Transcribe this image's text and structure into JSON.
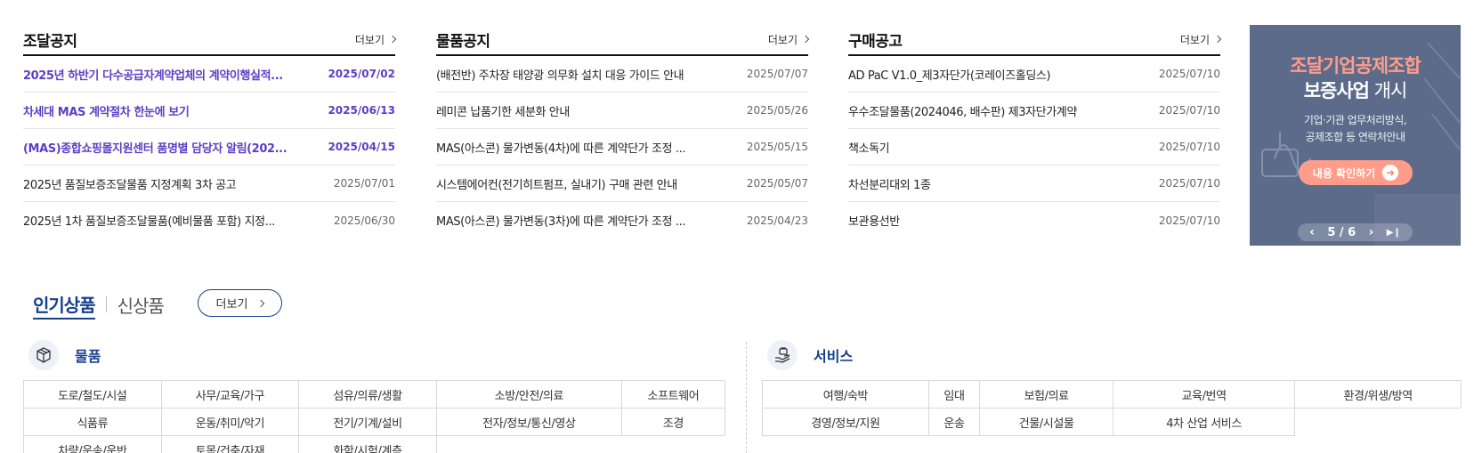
{
  "notices": [
    {
      "title": "조달공지",
      "more": "더보기",
      "items": [
        {
          "title": "2025년 하반기 다수공급자계약업체의 계약이행실적...",
          "date": "2025/07/02",
          "hl": true
        },
        {
          "title": "차세대 MAS 계약절차 한눈에 보기",
          "date": "2025/06/13",
          "hl": true
        },
        {
          "title": "(MAS)종합쇼핑몰지원센터 품명별 담당자 알림(202...",
          "date": "2025/04/15",
          "hl": true
        },
        {
          "title": "2025년 품질보증조달물품 지정계획 3차 공고",
          "date": "2025/07/01",
          "hl": false
        },
        {
          "title": "2025년 1차 품질보증조달물품(예비물품 포함) 지정...",
          "date": "2025/06/30",
          "hl": false
        }
      ]
    },
    {
      "title": "물품공지",
      "more": "더보기",
      "items": [
        {
          "title": "(배전반) 주차장 태양광 의무화 설치 대응 가이드 안내",
          "date": "2025/07/07",
          "hl": false
        },
        {
          "title": "레미콘 납품기한 세분화 안내",
          "date": "2025/05/26",
          "hl": false
        },
        {
          "title": "MAS(아스콘) 물가변동(4차)에 따른 계약단가 조정 ...",
          "date": "2025/05/15",
          "hl": false
        },
        {
          "title": "시스템에어컨(전기히트펌프, 실내기) 구매 관련 안내",
          "date": "2025/05/07",
          "hl": false
        },
        {
          "title": "MAS(아스콘) 물가변동(3차)에 따른 계약단가 조정 ...",
          "date": "2025/04/23",
          "hl": false
        }
      ]
    },
    {
      "title": "구매공고",
      "more": "더보기",
      "items": [
        {
          "title": "AD PaC V1.0_제3자단가(코레이즈홀딩스)",
          "date": "2025/07/10",
          "hl": false
        },
        {
          "title": "우수조달물품(2024046, 배수판) 제3자단가계약",
          "date": "2025/07/10",
          "hl": false
        },
        {
          "title": "책소독기",
          "date": "2025/07/10",
          "hl": false
        },
        {
          "title": "차선분리대외 1종",
          "date": "2025/07/10",
          "hl": false
        },
        {
          "title": "보관용선반",
          "date": "2025/07/10",
          "hl": false
        }
      ]
    }
  ],
  "banner": {
    "title_line1": "조달기업공제조합",
    "title_line2_bold": "보증사업",
    "title_line2_rest": " 개시",
    "sub_line1": "기업·기관 업무처리방식,",
    "sub_line2": "공제조합 등 연락처안내",
    "button_label": "내용 확인하기",
    "pager": "5 / 6",
    "colors": {
      "background": "#5c6b8a",
      "accent": "#ff9c8a"
    }
  },
  "products": {
    "tab_popular": "인기상품",
    "tab_new": "신상품",
    "more": "더보기",
    "goods": {
      "label": "물품",
      "rows": [
        [
          "도로/철도/시설",
          "사무/교육/가구",
          "섬유/의류/생활",
          "소방/안전/의료",
          "소프트웨어"
        ],
        [
          "식품류",
          "운동/취미/악기",
          "전기/기계/설비",
          "전자/정보/통신/영상",
          "조경"
        ],
        [
          "차량/운송/운반",
          "토목/건축/자재",
          "화학/시험/계측",
          "",
          ""
        ]
      ]
    },
    "services": {
      "label": "서비스",
      "rows": [
        [
          "여행/숙박",
          "임대",
          "보험/의료",
          "교육/번역",
          "환경/위생/방역"
        ],
        [
          "경영/정보/지원",
          "운송",
          "건물/시설물",
          "4차 산업 서비스",
          ""
        ]
      ]
    }
  }
}
